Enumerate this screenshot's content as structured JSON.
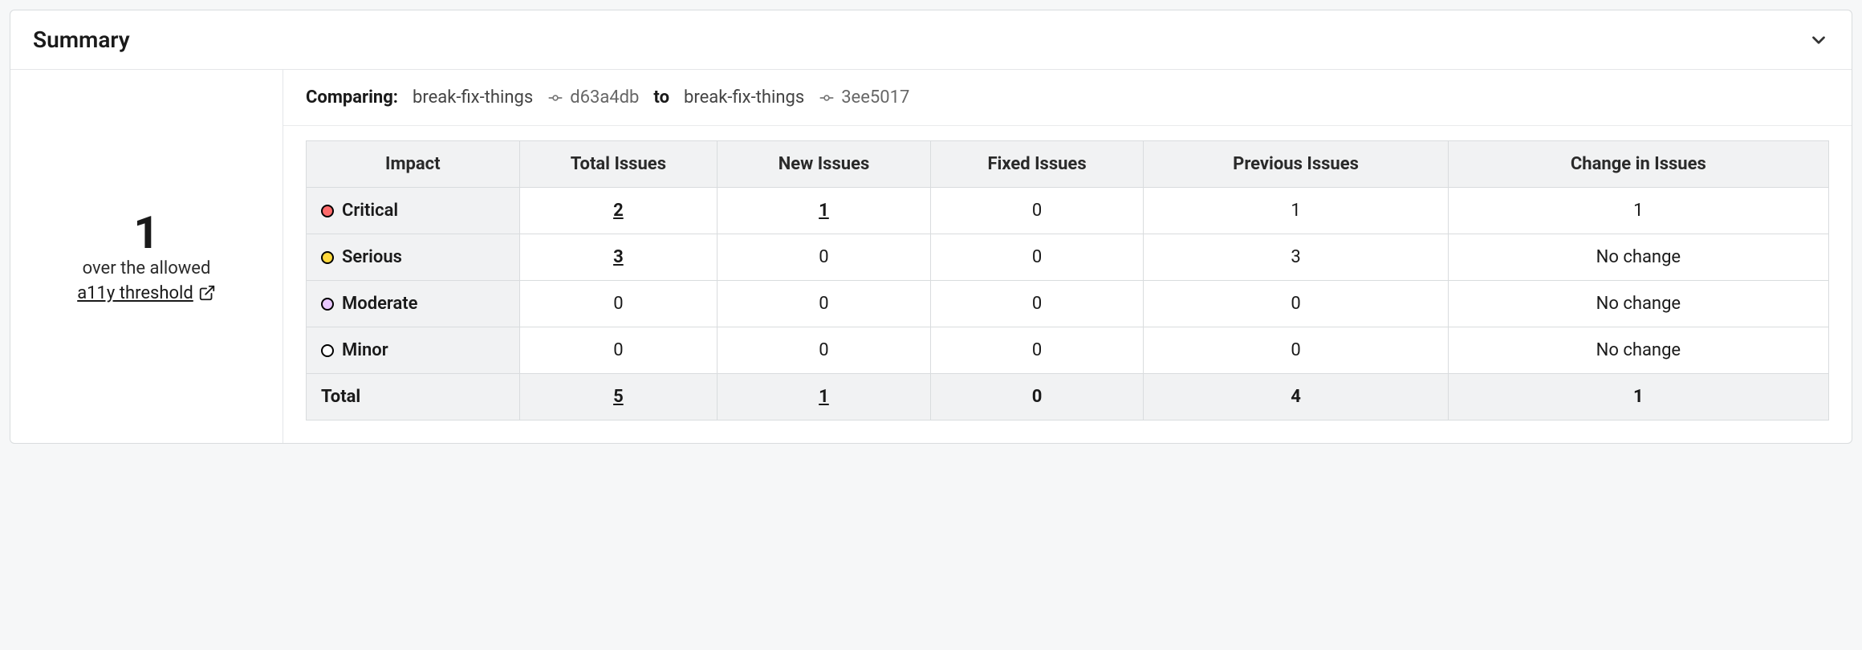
{
  "colors": {
    "critical": "#ff6b6b",
    "serious": "#ffd93d",
    "moderate": "#e9c8ff",
    "minor": "#ffffff",
    "highlight_border": "#e83fd3"
  },
  "header": {
    "title": "Summary"
  },
  "side": {
    "count": "1",
    "subtext": "over the allowed",
    "link_text": "a11y threshold"
  },
  "compare": {
    "label": "Comparing:",
    "from_branch": "break-fix-things",
    "from_commit": "d63a4db",
    "to_word": "to",
    "to_branch": "break-fix-things",
    "to_commit": "3ee5017"
  },
  "table": {
    "headers": {
      "impact": "Impact",
      "total": "Total Issues",
      "new": "New Issues",
      "fixed": "Fixed Issues",
      "previous": "Previous Issues",
      "change": "Change in Issues"
    },
    "rows": [
      {
        "impact": "Critical",
        "dot_color": "#ff6b6b",
        "total": "2",
        "total_link": true,
        "new": "1",
        "new_link": true,
        "fixed": "0",
        "previous": "1",
        "change": "1"
      },
      {
        "impact": "Serious",
        "dot_color": "#ffd93d",
        "total": "3",
        "total_link": true,
        "new": "0",
        "new_link": false,
        "fixed": "0",
        "previous": "3",
        "change": "No change"
      },
      {
        "impact": "Moderate",
        "dot_color": "#e9c8ff",
        "total": "0",
        "total_link": false,
        "new": "0",
        "new_link": false,
        "fixed": "0",
        "previous": "0",
        "change": "No change"
      },
      {
        "impact": "Minor",
        "dot_color": "#ffffff",
        "total": "0",
        "total_link": false,
        "new": "0",
        "new_link": false,
        "fixed": "0",
        "previous": "0",
        "change": "No change"
      }
    ],
    "total": {
      "label": "Total",
      "total": "5",
      "new": "1",
      "fixed": "0",
      "previous": "4",
      "change": "1"
    }
  },
  "highlight_column": "new"
}
